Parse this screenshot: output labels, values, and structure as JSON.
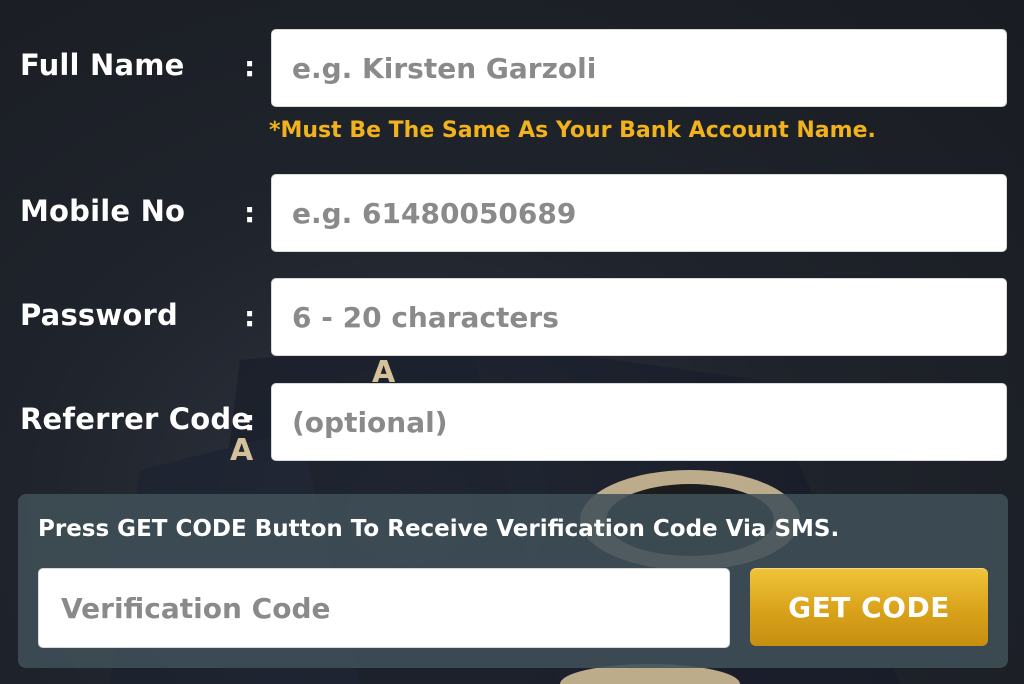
{
  "form": {
    "full_name": {
      "label": "Full Name",
      "colon": ":",
      "placeholder": "e.g. Kirsten Garzoli",
      "hint": "*Must Be The Same As Your Bank Account Name."
    },
    "mobile": {
      "label": "Mobile No",
      "colon": ":",
      "placeholder": "e.g. 61480050689"
    },
    "password": {
      "label": "Password",
      "colon": ":",
      "placeholder": "6 - 20 characters"
    },
    "referrer": {
      "label": "Referrer Code",
      "colon": ":",
      "placeholder": "(optional)"
    }
  },
  "verification": {
    "instruction": "Press GET CODE Button To Receive Verification Code Via SMS.",
    "placeholder": "Verification Code",
    "button_label": "GET CODE"
  },
  "colors": {
    "hint": "#f2b21c",
    "button": "#d9a21a",
    "panel": "#405058",
    "background": "#1f232b"
  }
}
